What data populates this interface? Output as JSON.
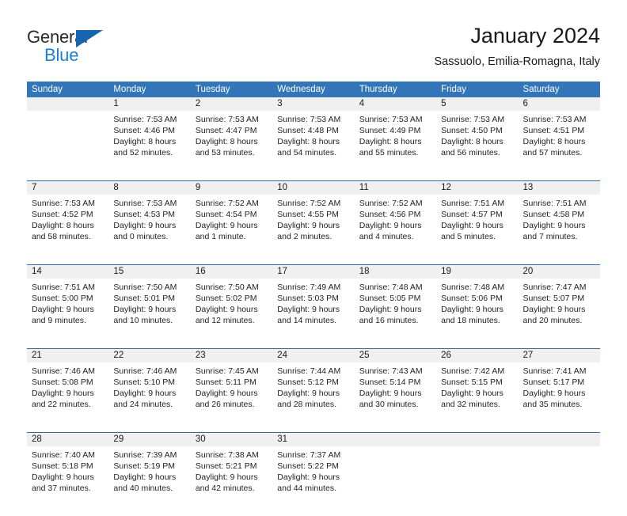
{
  "brand": {
    "name_part1": "General",
    "name_part2": "Blue",
    "triangle_color": "#1565b0",
    "blue_color": "#1b7fd4",
    "dark_color": "#2b2b2b"
  },
  "header": {
    "title": "January 2024",
    "subtitle": "Sassuolo, Emilia-Romagna, Italy"
  },
  "theme": {
    "header_blue": "#3275b8",
    "row_line_blue": "#2e6da8",
    "day_band_gray": "#f0f0f0"
  },
  "weekdays": [
    "Sunday",
    "Monday",
    "Tuesday",
    "Wednesday",
    "Thursday",
    "Friday",
    "Saturday"
  ],
  "weeks": [
    [
      {
        "day": "",
        "sunrise": "",
        "sunset": "",
        "daylight1": "",
        "daylight2": ""
      },
      {
        "day": "1",
        "sunrise": "Sunrise: 7:53 AM",
        "sunset": "Sunset: 4:46 PM",
        "daylight1": "Daylight: 8 hours",
        "daylight2": "and 52 minutes."
      },
      {
        "day": "2",
        "sunrise": "Sunrise: 7:53 AM",
        "sunset": "Sunset: 4:47 PM",
        "daylight1": "Daylight: 8 hours",
        "daylight2": "and 53 minutes."
      },
      {
        "day": "3",
        "sunrise": "Sunrise: 7:53 AM",
        "sunset": "Sunset: 4:48 PM",
        "daylight1": "Daylight: 8 hours",
        "daylight2": "and 54 minutes."
      },
      {
        "day": "4",
        "sunrise": "Sunrise: 7:53 AM",
        "sunset": "Sunset: 4:49 PM",
        "daylight1": "Daylight: 8 hours",
        "daylight2": "and 55 minutes."
      },
      {
        "day": "5",
        "sunrise": "Sunrise: 7:53 AM",
        "sunset": "Sunset: 4:50 PM",
        "daylight1": "Daylight: 8 hours",
        "daylight2": "and 56 minutes."
      },
      {
        "day": "6",
        "sunrise": "Sunrise: 7:53 AM",
        "sunset": "Sunset: 4:51 PM",
        "daylight1": "Daylight: 8 hours",
        "daylight2": "and 57 minutes."
      }
    ],
    [
      {
        "day": "7",
        "sunrise": "Sunrise: 7:53 AM",
        "sunset": "Sunset: 4:52 PM",
        "daylight1": "Daylight: 8 hours",
        "daylight2": "and 58 minutes."
      },
      {
        "day": "8",
        "sunrise": "Sunrise: 7:53 AM",
        "sunset": "Sunset: 4:53 PM",
        "daylight1": "Daylight: 9 hours",
        "daylight2": "and 0 minutes."
      },
      {
        "day": "9",
        "sunrise": "Sunrise: 7:52 AM",
        "sunset": "Sunset: 4:54 PM",
        "daylight1": "Daylight: 9 hours",
        "daylight2": "and 1 minute."
      },
      {
        "day": "10",
        "sunrise": "Sunrise: 7:52 AM",
        "sunset": "Sunset: 4:55 PM",
        "daylight1": "Daylight: 9 hours",
        "daylight2": "and 2 minutes."
      },
      {
        "day": "11",
        "sunrise": "Sunrise: 7:52 AM",
        "sunset": "Sunset: 4:56 PM",
        "daylight1": "Daylight: 9 hours",
        "daylight2": "and 4 minutes."
      },
      {
        "day": "12",
        "sunrise": "Sunrise: 7:51 AM",
        "sunset": "Sunset: 4:57 PM",
        "daylight1": "Daylight: 9 hours",
        "daylight2": "and 5 minutes."
      },
      {
        "day": "13",
        "sunrise": "Sunrise: 7:51 AM",
        "sunset": "Sunset: 4:58 PM",
        "daylight1": "Daylight: 9 hours",
        "daylight2": "and 7 minutes."
      }
    ],
    [
      {
        "day": "14",
        "sunrise": "Sunrise: 7:51 AM",
        "sunset": "Sunset: 5:00 PM",
        "daylight1": "Daylight: 9 hours",
        "daylight2": "and 9 minutes."
      },
      {
        "day": "15",
        "sunrise": "Sunrise: 7:50 AM",
        "sunset": "Sunset: 5:01 PM",
        "daylight1": "Daylight: 9 hours",
        "daylight2": "and 10 minutes."
      },
      {
        "day": "16",
        "sunrise": "Sunrise: 7:50 AM",
        "sunset": "Sunset: 5:02 PM",
        "daylight1": "Daylight: 9 hours",
        "daylight2": "and 12 minutes."
      },
      {
        "day": "17",
        "sunrise": "Sunrise: 7:49 AM",
        "sunset": "Sunset: 5:03 PM",
        "daylight1": "Daylight: 9 hours",
        "daylight2": "and 14 minutes."
      },
      {
        "day": "18",
        "sunrise": "Sunrise: 7:48 AM",
        "sunset": "Sunset: 5:05 PM",
        "daylight1": "Daylight: 9 hours",
        "daylight2": "and 16 minutes."
      },
      {
        "day": "19",
        "sunrise": "Sunrise: 7:48 AM",
        "sunset": "Sunset: 5:06 PM",
        "daylight1": "Daylight: 9 hours",
        "daylight2": "and 18 minutes."
      },
      {
        "day": "20",
        "sunrise": "Sunrise: 7:47 AM",
        "sunset": "Sunset: 5:07 PM",
        "daylight1": "Daylight: 9 hours",
        "daylight2": "and 20 minutes."
      }
    ],
    [
      {
        "day": "21",
        "sunrise": "Sunrise: 7:46 AM",
        "sunset": "Sunset: 5:08 PM",
        "daylight1": "Daylight: 9 hours",
        "daylight2": "and 22 minutes."
      },
      {
        "day": "22",
        "sunrise": "Sunrise: 7:46 AM",
        "sunset": "Sunset: 5:10 PM",
        "daylight1": "Daylight: 9 hours",
        "daylight2": "and 24 minutes."
      },
      {
        "day": "23",
        "sunrise": "Sunrise: 7:45 AM",
        "sunset": "Sunset: 5:11 PM",
        "daylight1": "Daylight: 9 hours",
        "daylight2": "and 26 minutes."
      },
      {
        "day": "24",
        "sunrise": "Sunrise: 7:44 AM",
        "sunset": "Sunset: 5:12 PM",
        "daylight1": "Daylight: 9 hours",
        "daylight2": "and 28 minutes."
      },
      {
        "day": "25",
        "sunrise": "Sunrise: 7:43 AM",
        "sunset": "Sunset: 5:14 PM",
        "daylight1": "Daylight: 9 hours",
        "daylight2": "and 30 minutes."
      },
      {
        "day": "26",
        "sunrise": "Sunrise: 7:42 AM",
        "sunset": "Sunset: 5:15 PM",
        "daylight1": "Daylight: 9 hours",
        "daylight2": "and 32 minutes."
      },
      {
        "day": "27",
        "sunrise": "Sunrise: 7:41 AM",
        "sunset": "Sunset: 5:17 PM",
        "daylight1": "Daylight: 9 hours",
        "daylight2": "and 35 minutes."
      }
    ],
    [
      {
        "day": "28",
        "sunrise": "Sunrise: 7:40 AM",
        "sunset": "Sunset: 5:18 PM",
        "daylight1": "Daylight: 9 hours",
        "daylight2": "and 37 minutes."
      },
      {
        "day": "29",
        "sunrise": "Sunrise: 7:39 AM",
        "sunset": "Sunset: 5:19 PM",
        "daylight1": "Daylight: 9 hours",
        "daylight2": "and 40 minutes."
      },
      {
        "day": "30",
        "sunrise": "Sunrise: 7:38 AM",
        "sunset": "Sunset: 5:21 PM",
        "daylight1": "Daylight: 9 hours",
        "daylight2": "and 42 minutes."
      },
      {
        "day": "31",
        "sunrise": "Sunrise: 7:37 AM",
        "sunset": "Sunset: 5:22 PM",
        "daylight1": "Daylight: 9 hours",
        "daylight2": "and 44 minutes."
      },
      {
        "day": "",
        "sunrise": "",
        "sunset": "",
        "daylight1": "",
        "daylight2": ""
      },
      {
        "day": "",
        "sunrise": "",
        "sunset": "",
        "daylight1": "",
        "daylight2": ""
      },
      {
        "day": "",
        "sunrise": "",
        "sunset": "",
        "daylight1": "",
        "daylight2": ""
      }
    ]
  ]
}
